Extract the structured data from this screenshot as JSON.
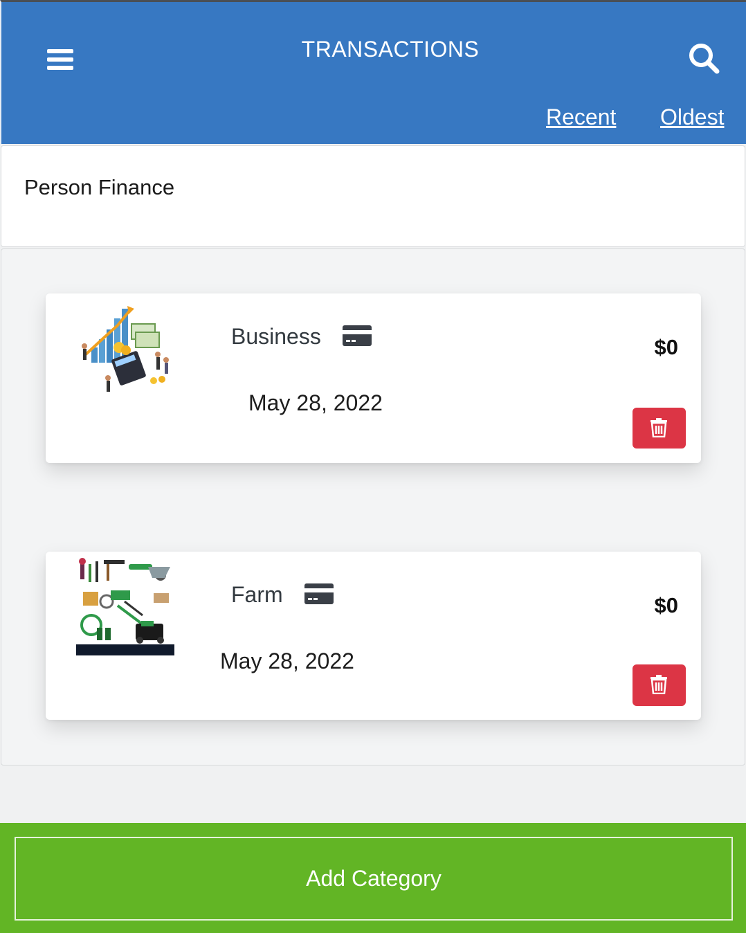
{
  "header": {
    "title": "TRANSACTIONS",
    "sort_recent": "Recent",
    "sort_oldest": "Oldest",
    "menu_icon": "hamburger-icon",
    "search_icon": "search-icon"
  },
  "finance": {
    "title": "Person Finance"
  },
  "categories": [
    {
      "name": "Business",
      "date": "May 28, 2022",
      "amount": "$0",
      "image": "business-illustration",
      "icon": "credit-card-icon"
    },
    {
      "name": "Farm",
      "date": "May 28, 2022",
      "amount": "$0",
      "image": "farm-tools-illustration",
      "icon": "credit-card-icon"
    }
  ],
  "footer": {
    "add_label": "Add Category"
  },
  "colors": {
    "header": "#3778c2",
    "delete": "#dc3545",
    "footer": "#62b525"
  }
}
